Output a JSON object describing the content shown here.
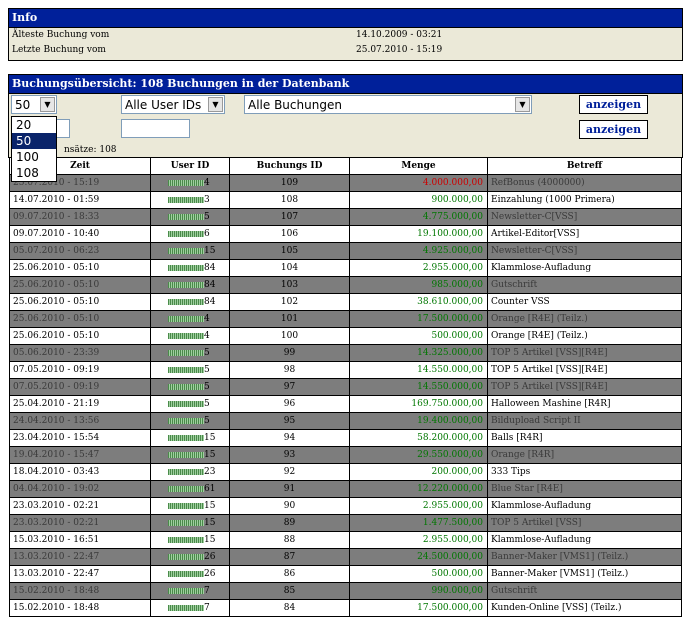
{
  "info": {
    "title": "Info",
    "rows": [
      {
        "label": "Älteste Buchung vom",
        "value": "14.10.2009 - 03:21"
      },
      {
        "label": "Letzte Buchung vom",
        "value": "25.07.2010 - 15:19"
      }
    ]
  },
  "overview": {
    "title": "Buchungsübersicht: 108 Buchungen in der Datenbank",
    "count_text": "nsätze: 108",
    "limit_select": {
      "value": "50",
      "options": [
        "20",
        "50",
        "100",
        "108"
      ],
      "selected_index": 1
    },
    "user_select": {
      "value": "Alle User IDs"
    },
    "type_select": {
      "value": "Alle Buchungen"
    },
    "button1": "anzeigen",
    "button2": "anzeigen",
    "columns": [
      "Zeit",
      "User ID",
      "Buchungs ID",
      "Menge",
      "Betreff"
    ],
    "rows": [
      {
        "zeit": "25.07.2010 - 15:19",
        "uid": "4",
        "bid": "109",
        "menge": "4.000.000,00",
        "betreff": "RefBonus (4000000)",
        "color": "#cc0000",
        "shade": "g"
      },
      {
        "zeit": "14.07.2010 - 01:59",
        "uid": "3",
        "bid": "108",
        "menge": "900.000,00",
        "betreff": "Einzahlung (1000 Primera)",
        "color": "#007700",
        "shade": "w"
      },
      {
        "zeit": "09.07.2010 - 18:33",
        "uid": "5",
        "bid": "107",
        "menge": "4.775.000,00",
        "betreff": "Newsletter-C[VSS]",
        "color": "#007700",
        "shade": "g"
      },
      {
        "zeit": "09.07.2010 - 10:40",
        "uid": "6",
        "bid": "106",
        "menge": "19.100.000,00",
        "betreff": "Artikel-Editor[VSS]",
        "color": "#007700",
        "shade": "w"
      },
      {
        "zeit": "05.07.2010 - 06:23",
        "uid": "15",
        "bid": "105",
        "menge": "4.925.000,00",
        "betreff": "Newsletter-C[VSS]",
        "color": "#007700",
        "shade": "g"
      },
      {
        "zeit": "25.06.2010 - 05:10",
        "uid": "84",
        "bid": "104",
        "menge": "2.955.000,00",
        "betreff": "Klammlose-Aufladung",
        "color": "#007700",
        "shade": "w"
      },
      {
        "zeit": "25.06.2010 - 05:10",
        "uid": "84",
        "bid": "103",
        "menge": "985.000,00",
        "betreff": "Gutschrift",
        "color": "#007700",
        "shade": "g"
      },
      {
        "zeit": "25.06.2010 - 05:10",
        "uid": "84",
        "bid": "102",
        "menge": "38.610.000,00",
        "betreff": "Counter VSS",
        "color": "#007700",
        "shade": "w"
      },
      {
        "zeit": "25.06.2010 - 05:10",
        "uid": "4",
        "bid": "101",
        "menge": "17.500.000,00",
        "betreff": "Orange [R4E] (Teilz.)",
        "color": "#007700",
        "shade": "g"
      },
      {
        "zeit": "25.06.2010 - 05:10",
        "uid": "4",
        "bid": "100",
        "menge": "500.000,00",
        "betreff": "Orange [R4E] (Teilz.)",
        "color": "#007700",
        "shade": "w"
      },
      {
        "zeit": "05.06.2010 - 23:39",
        "uid": "5",
        "bid": "99",
        "menge": "14.325.000,00",
        "betreff": "TOP 5 Artikel [VSS][R4E]",
        "color": "#007700",
        "shade": "g"
      },
      {
        "zeit": "07.05.2010 - 09:19",
        "uid": "5",
        "bid": "98",
        "menge": "14.550.000,00",
        "betreff": "TOP 5 Artikel [VSS][R4E]",
        "color": "#007700",
        "shade": "w"
      },
      {
        "zeit": "07.05.2010 - 09:19",
        "uid": "5",
        "bid": "97",
        "menge": "14.550.000,00",
        "betreff": "TOP 5 Artikel [VSS][R4E]",
        "color": "#007700",
        "shade": "g"
      },
      {
        "zeit": "25.04.2010 - 21:19",
        "uid": "5",
        "bid": "96",
        "menge": "169.750.000,00",
        "betreff": "Halloween Mashine [R4R]",
        "color": "#007700",
        "shade": "w"
      },
      {
        "zeit": "24.04.2010 - 13:56",
        "uid": "5",
        "bid": "95",
        "menge": "19.400.000,00",
        "betreff": "Bildupload Script II",
        "color": "#007700",
        "shade": "g"
      },
      {
        "zeit": "23.04.2010 - 15:54",
        "uid": "15",
        "bid": "94",
        "menge": "58.200.000,00",
        "betreff": "Balls [R4R]",
        "color": "#007700",
        "shade": "w"
      },
      {
        "zeit": "19.04.2010 - 15:47",
        "uid": "15",
        "bid": "93",
        "menge": "29.550.000,00",
        "betreff": "Orange [R4R]",
        "color": "#007700",
        "shade": "g"
      },
      {
        "zeit": "18.04.2010 - 03:43",
        "uid": "23",
        "bid": "92",
        "menge": "200.000,00",
        "betreff": "333 Tips",
        "color": "#007700",
        "shade": "w"
      },
      {
        "zeit": "04.04.2010 - 19:02",
        "uid": "61",
        "bid": "91",
        "menge": "12.220.000,00",
        "betreff": "Blue Star [R4E]",
        "color": "#007700",
        "shade": "g"
      },
      {
        "zeit": "23.03.2010 - 02:21",
        "uid": "15",
        "bid": "90",
        "menge": "2.955.000,00",
        "betreff": "Klammlose-Aufladung",
        "color": "#007700",
        "shade": "w"
      },
      {
        "zeit": "23.03.2010 - 02:21",
        "uid": "15",
        "bid": "89",
        "menge": "1.477.500,00",
        "betreff": "TOP 5 Artikel [VSS]",
        "color": "#007700",
        "shade": "g"
      },
      {
        "zeit": "15.03.2010 - 16:51",
        "uid": "15",
        "bid": "88",
        "menge": "2.955.000,00",
        "betreff": "Klammlose-Aufladung",
        "color": "#007700",
        "shade": "w"
      },
      {
        "zeit": "13.03.2010 - 22:47",
        "uid": "26",
        "bid": "87",
        "menge": "24.500.000,00",
        "betreff": "Banner-Maker [VMS1] (Teilz.)",
        "color": "#007700",
        "shade": "g"
      },
      {
        "zeit": "13.03.2010 - 22:47",
        "uid": "26",
        "bid": "86",
        "menge": "500.000,00",
        "betreff": "Banner-Maker [VMS1] (Teilz.)",
        "color": "#007700",
        "shade": "w"
      },
      {
        "zeit": "15.02.2010 - 18:48",
        "uid": "7",
        "bid": "85",
        "menge": "990.000,00",
        "betreff": "Gutschrift",
        "color": "#007700",
        "shade": "g"
      },
      {
        "zeit": "15.02.2010 - 18:48",
        "uid": "7",
        "bid": "84",
        "menge": "17.500.000,00",
        "betreff": "Kunden-Online [VSS] (Teilz.)",
        "color": "#007700",
        "shade": "w"
      }
    ]
  }
}
